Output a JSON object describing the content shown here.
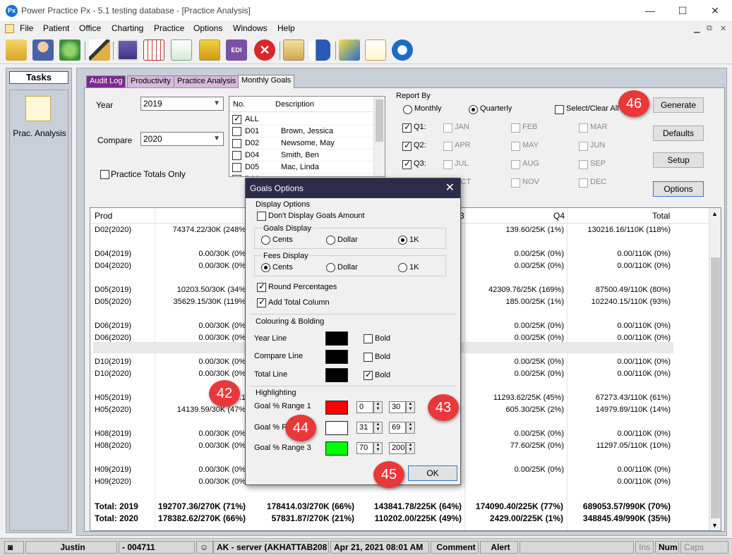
{
  "window": {
    "title": "Power Practice Px - 5.1 testing database - [Practice Analysis]",
    "app_icon": "Px"
  },
  "menu": [
    "File",
    "Patient",
    "Office",
    "Charting",
    "Practice",
    "Options",
    "Windows",
    "Help"
  ],
  "toolbar_icons": [
    "open-folder-icon",
    "patients-icon",
    "transfer-icon",
    "edit-pencil-icon",
    "book-icon",
    "calendar-icon",
    "reports-icon",
    "gift-box-icon",
    "edi-icon",
    "stop-icon",
    "document-icon",
    "lab-bottle-icon",
    "notes-icon",
    "memo-icon",
    "info-icon"
  ],
  "tasks": {
    "header": "Tasks",
    "items": [
      {
        "label": "Prac. Analysis"
      }
    ]
  },
  "tabs": [
    "Audit Log",
    "Productivity",
    "Practice Analysis",
    "Monthly Goals"
  ],
  "filters": {
    "year_label": "Year",
    "year_value": "2019",
    "compare_label": "Compare",
    "compare_value": "2020",
    "practice_totals_label": "Practice Totals Only"
  },
  "provider_list": {
    "headers": [
      "No.",
      "Description"
    ],
    "rows": [
      {
        "no": "ALL",
        "desc": "",
        "checked": true
      },
      {
        "no": "D01",
        "desc": "Brown, Jessica",
        "checked": false
      },
      {
        "no": "D02",
        "desc": "Newsome, May",
        "checked": false
      },
      {
        "no": "D04",
        "desc": "Smith, Ben",
        "checked": false
      },
      {
        "no": "D05",
        "desc": "Mac, Linda",
        "checked": false
      },
      {
        "no": "D06",
        "desc": "",
        "checked": false
      },
      {
        "no": "D07",
        "desc": "",
        "checked": false
      }
    ]
  },
  "report_by": {
    "label": "Report By",
    "monthly": "Monthly",
    "quarterly": "Quarterly",
    "select_clear": "Select/Clear All",
    "quarters": [
      "Q1:",
      "Q2:",
      "Q3:"
    ],
    "months": [
      [
        "JAN",
        "FEB",
        "MAR"
      ],
      [
        "APR",
        "MAY",
        "JUN"
      ],
      [
        "JUL",
        "AUG",
        "SEP"
      ],
      [
        "OCT",
        "NOV",
        "DEC"
      ]
    ]
  },
  "buttons": {
    "generate": "Generate",
    "defaults": "Defaults",
    "setup": "Setup",
    "options": "Options"
  },
  "grid": {
    "headers": {
      "prod": "Prod",
      "q4": "Q4",
      "total": "Total",
      "q3_fragment": "3"
    },
    "rows": [
      {
        "prod": "D02(2020)",
        "q1": "74374.22/30K (248%",
        "q4": "139.60/25K (1%)",
        "total": "130216.16/110K (118%)"
      },
      {
        "prod": "D04(2019)",
        "q1": "0.00/30K (0%",
        "q4": "0.00/25K (0%)",
        "total": "0.00/110K (0%)"
      },
      {
        "prod": "D04(2020)",
        "q1": "0.00/30K (0%",
        "q4": "0.00/25K (0%)",
        "total": "0.00/110K (0%)"
      },
      {
        "prod": "D05(2019)",
        "q1": "10203.50/30K (34%",
        "q4": "42309.76/25K (169%)",
        "total": "87500.49/110K (80%)"
      },
      {
        "prod": "D05(2020)",
        "q1": "35629.15/30K (119%",
        "q4": "185.00/25K (1%)",
        "total": "102240.15/110K (93%)"
      },
      {
        "prod": "D06(2019)",
        "q1": "0.00/30K (0%",
        "q4": "0.00/25K (0%)",
        "total": "0.00/110K (0%)"
      },
      {
        "prod": "D06(2020)",
        "q1": "0.00/30K (0%",
        "q4": "0.00/25K (0%)",
        "total": "0.00/110K (0%)"
      },
      {
        "prod": "D10(2019)",
        "q1": "0.00/30K (0%",
        "q4": "0.00/25K (0%)",
        "total": "0.00/110K (0%)"
      },
      {
        "prod": "D10(2020)",
        "q1": "0.00/30K (0%",
        "q4": "0.00/25K (0%)",
        "total": "0.00/110K (0%)"
      },
      {
        "prod": "H05(2019)",
        "q1": "18870.1",
        "q4": "11293.62/25K (45%)",
        "total": "67273.43/110K (61%)"
      },
      {
        "prod": "H05(2020)",
        "q1": "14139.59/30K (47%",
        "q4": "605.30/25K (2%)",
        "total": "14979.89/110K (14%)"
      },
      {
        "prod": "H08(2019)",
        "q1": "0.00/30K (0%",
        "q4": "0.00/25K (0%)",
        "total": "0.00/110K (0%)"
      },
      {
        "prod": "H08(2020)",
        "q1": "0.00/30K (0%",
        "q4": "77.60/25K (0%)",
        "total": "11297.05/110K (10%)"
      },
      {
        "prod": "H09(2019)",
        "q1": "0.00/30K (0%",
        "q4": "0.00/25K (0%)",
        "total": "0.00/110K (0%)"
      },
      {
        "prod": "H09(2020)",
        "q1": "0.00/30K (0%",
        "q4": "",
        "total": "0.00/110K (0%)"
      }
    ],
    "totals": [
      {
        "label": "Total: 2019",
        "q1": "192707.36/270K (71%)",
        "q2": "178414.03/270K (66%)",
        "q3": "143841.78/225K (64%)",
        "q4": "174090.40/225K (77%)",
        "total": "689053.57/990K (70%)"
      },
      {
        "label": "Total: 2020",
        "q1": "178382.62/270K (66%)",
        "q2": "57831.87/270K (21%)",
        "q3": "110202.00/225K (49%)",
        "q4": "2429.00/225K (1%)",
        "total": "348845.49/990K (35%)"
      }
    ]
  },
  "dialog": {
    "title": "Goals Options",
    "display_options": "Display Options",
    "dont_display": "Don't Display Goals Amount",
    "goals_display": "Goals Display",
    "fees_display": "Fees Display",
    "cents": "Cents",
    "dollar": "Dollar",
    "onek": "1K",
    "round": "Round Percentages",
    "add_total": "Add Total Column",
    "colouring": "Colouring & Bolding",
    "year_line": "Year Line",
    "compare_line": "Compare Line",
    "total_line": "Total Line",
    "bold": "Bold",
    "highlighting": "Highlighting",
    "range1": "Goal % Range 1",
    "range2": "Goal % R",
    "range3": "Goal % Range 3",
    "r1_from": "0",
    "r1_to": "30",
    "r2_from": "31",
    "r2_to": "69",
    "r3_from": "70",
    "r3_to": "200",
    "ok": "OK",
    "colors": {
      "line": "#000000",
      "range1": "#ff0000",
      "range2": "#ffffff",
      "range3": "#00ff00"
    }
  },
  "callouts": [
    "42",
    "43",
    "44",
    "45",
    "46"
  ],
  "status": {
    "user": "Justin",
    "code": "- 004711",
    "server": "AK - server (AKHATTAB208",
    "datetime": "Apr 21, 2021 08:01 AM",
    "comment": "Comment",
    "alert": "Alert",
    "ins": "Ins",
    "num": "Num",
    "caps": "Caps"
  },
  "colors": {
    "accent_callout": "#e8383a",
    "tab_active": "#f0f0f0",
    "tab_purple": "#7b2b8c",
    "tab_light_purple": "#d8b8dc"
  }
}
